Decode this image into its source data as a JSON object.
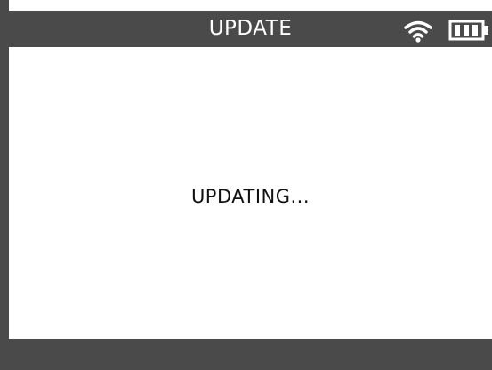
{
  "header": {
    "title": "UPDATE",
    "icons": [
      "wifi-icon",
      "battery-icon"
    ],
    "background_color": "#4a4a4a",
    "text_color": "#ffffff"
  },
  "main": {
    "status_message": "UPDATING..."
  },
  "colors": {
    "frame": "#4a4a4a",
    "content_background": "#ffffff",
    "text": "#111111"
  }
}
